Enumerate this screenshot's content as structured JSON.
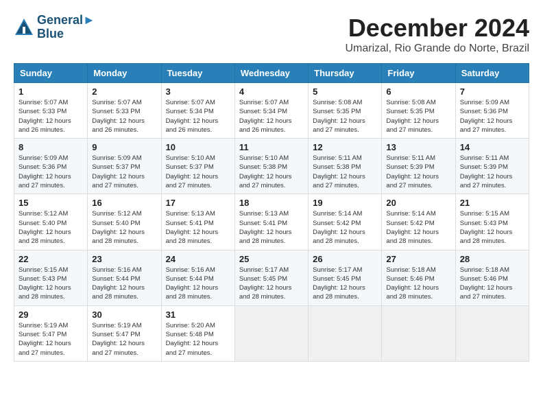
{
  "logo": {
    "line1": "General",
    "line2": "Blue"
  },
  "title": "December 2024",
  "subtitle": "Umarizal, Rio Grande do Norte, Brazil",
  "days_of_week": [
    "Sunday",
    "Monday",
    "Tuesday",
    "Wednesday",
    "Thursday",
    "Friday",
    "Saturday"
  ],
  "weeks": [
    [
      {
        "day": "1",
        "sunrise": "5:07 AM",
        "sunset": "5:33 PM",
        "daylight": "12 hours and 26 minutes."
      },
      {
        "day": "2",
        "sunrise": "5:07 AM",
        "sunset": "5:33 PM",
        "daylight": "12 hours and 26 minutes."
      },
      {
        "day": "3",
        "sunrise": "5:07 AM",
        "sunset": "5:34 PM",
        "daylight": "12 hours and 26 minutes."
      },
      {
        "day": "4",
        "sunrise": "5:07 AM",
        "sunset": "5:34 PM",
        "daylight": "12 hours and 26 minutes."
      },
      {
        "day": "5",
        "sunrise": "5:08 AM",
        "sunset": "5:35 PM",
        "daylight": "12 hours and 27 minutes."
      },
      {
        "day": "6",
        "sunrise": "5:08 AM",
        "sunset": "5:35 PM",
        "daylight": "12 hours and 27 minutes."
      },
      {
        "day": "7",
        "sunrise": "5:09 AM",
        "sunset": "5:36 PM",
        "daylight": "12 hours and 27 minutes."
      }
    ],
    [
      {
        "day": "8",
        "sunrise": "5:09 AM",
        "sunset": "5:36 PM",
        "daylight": "12 hours and 27 minutes."
      },
      {
        "day": "9",
        "sunrise": "5:09 AM",
        "sunset": "5:37 PM",
        "daylight": "12 hours and 27 minutes."
      },
      {
        "day": "10",
        "sunrise": "5:10 AM",
        "sunset": "5:37 PM",
        "daylight": "12 hours and 27 minutes."
      },
      {
        "day": "11",
        "sunrise": "5:10 AM",
        "sunset": "5:38 PM",
        "daylight": "12 hours and 27 minutes."
      },
      {
        "day": "12",
        "sunrise": "5:11 AM",
        "sunset": "5:38 PM",
        "daylight": "12 hours and 27 minutes."
      },
      {
        "day": "13",
        "sunrise": "5:11 AM",
        "sunset": "5:39 PM",
        "daylight": "12 hours and 27 minutes."
      },
      {
        "day": "14",
        "sunrise": "5:11 AM",
        "sunset": "5:39 PM",
        "daylight": "12 hours and 27 minutes."
      }
    ],
    [
      {
        "day": "15",
        "sunrise": "5:12 AM",
        "sunset": "5:40 PM",
        "daylight": "12 hours and 28 minutes."
      },
      {
        "day": "16",
        "sunrise": "5:12 AM",
        "sunset": "5:40 PM",
        "daylight": "12 hours and 28 minutes."
      },
      {
        "day": "17",
        "sunrise": "5:13 AM",
        "sunset": "5:41 PM",
        "daylight": "12 hours and 28 minutes."
      },
      {
        "day": "18",
        "sunrise": "5:13 AM",
        "sunset": "5:41 PM",
        "daylight": "12 hours and 28 minutes."
      },
      {
        "day": "19",
        "sunrise": "5:14 AM",
        "sunset": "5:42 PM",
        "daylight": "12 hours and 28 minutes."
      },
      {
        "day": "20",
        "sunrise": "5:14 AM",
        "sunset": "5:42 PM",
        "daylight": "12 hours and 28 minutes."
      },
      {
        "day": "21",
        "sunrise": "5:15 AM",
        "sunset": "5:43 PM",
        "daylight": "12 hours and 28 minutes."
      }
    ],
    [
      {
        "day": "22",
        "sunrise": "5:15 AM",
        "sunset": "5:43 PM",
        "daylight": "12 hours and 28 minutes."
      },
      {
        "day": "23",
        "sunrise": "5:16 AM",
        "sunset": "5:44 PM",
        "daylight": "12 hours and 28 minutes."
      },
      {
        "day": "24",
        "sunrise": "5:16 AM",
        "sunset": "5:44 PM",
        "daylight": "12 hours and 28 minutes."
      },
      {
        "day": "25",
        "sunrise": "5:17 AM",
        "sunset": "5:45 PM",
        "daylight": "12 hours and 28 minutes."
      },
      {
        "day": "26",
        "sunrise": "5:17 AM",
        "sunset": "5:45 PM",
        "daylight": "12 hours and 28 minutes."
      },
      {
        "day": "27",
        "sunrise": "5:18 AM",
        "sunset": "5:46 PM",
        "daylight": "12 hours and 28 minutes."
      },
      {
        "day": "28",
        "sunrise": "5:18 AM",
        "sunset": "5:46 PM",
        "daylight": "12 hours and 27 minutes."
      }
    ],
    [
      {
        "day": "29",
        "sunrise": "5:19 AM",
        "sunset": "5:47 PM",
        "daylight": "12 hours and 27 minutes."
      },
      {
        "day": "30",
        "sunrise": "5:19 AM",
        "sunset": "5:47 PM",
        "daylight": "12 hours and 27 minutes."
      },
      {
        "day": "31",
        "sunrise": "5:20 AM",
        "sunset": "5:48 PM",
        "daylight": "12 hours and 27 minutes."
      },
      null,
      null,
      null,
      null
    ]
  ]
}
